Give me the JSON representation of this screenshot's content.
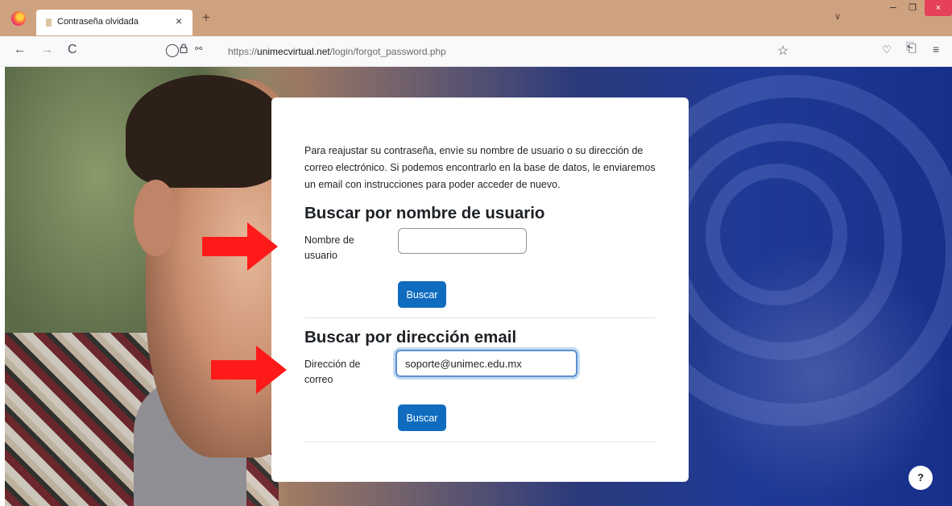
{
  "browser": {
    "tab": {
      "title": "Contraseña olvidada",
      "close": "×"
    },
    "new_tab": "+",
    "tabs_list": "∨",
    "window": {
      "minimize": "–",
      "maximize": "❐",
      "close": "×"
    },
    "nav": {
      "back": "←",
      "forward": "→",
      "reload": "C"
    },
    "url": {
      "domain": "unimecvirtual.net",
      "prefix": "https://",
      "path": "/login/forgot_password.php"
    },
    "icons": {
      "shield": "shield-icon",
      "lock": "lock-icon",
      "permissions": "permissions-icon",
      "star": "star-icon",
      "pocket": "pocket-icon",
      "extensions": "extensions-icon",
      "menu": "menu-icon"
    }
  },
  "form": {
    "instructions": "Para reajustar su contraseña, envíe su nombre de usuario o su dirección de correo electrónico. Si podemos encontrarlo en la base de datos, le enviaremos un email con instrucciones para poder acceder de nuevo.",
    "username_section": {
      "title": "Buscar por nombre de usuario",
      "label": "Nombre de usuario",
      "value": "",
      "button": "Buscar"
    },
    "email_section": {
      "title": "Buscar por dirección email",
      "label": "Dirección de correo",
      "value": "soporte@unimec.edu.mx",
      "button": "Buscar"
    }
  },
  "help_button": "?",
  "colors": {
    "primary": "#0f6cbf",
    "arrow": "#ff1a1a",
    "focus_border": "#5b8fd1",
    "tabbar": "#cfa27f"
  }
}
